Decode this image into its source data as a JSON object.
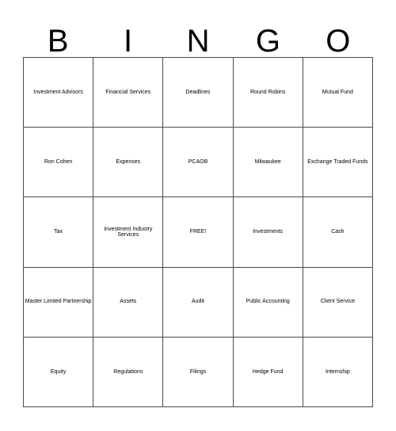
{
  "card": {
    "title": "BINGO Card",
    "header_letters": [
      "B",
      "I",
      "N",
      "G",
      "O"
    ],
    "free_space_label": "FREE!",
    "grid_size": "5x5",
    "colors": {
      "background": "#ffffff",
      "text": "#000000",
      "border": "#4a4a4a"
    },
    "columns": [
      {
        "letter": "B",
        "cells": [
          {
            "text": "Investment Advisors",
            "lines": 2,
            "size": "xxs"
          },
          {
            "text": "Ron Cohen",
            "lines": 2,
            "size": "lg"
          },
          {
            "text": "Tax",
            "lines": 1,
            "size": "xl"
          },
          {
            "text": "Master Limited Partnership",
            "lines": 3,
            "size": "tiny"
          },
          {
            "text": "Equity",
            "lines": 1,
            "size": "md"
          }
        ]
      },
      {
        "letter": "I",
        "cells": [
          {
            "text": "Financial Services",
            "lines": 2,
            "size": "md"
          },
          {
            "text": "Expenses",
            "lines": 1,
            "size": "xs"
          },
          {
            "text": "Investment Industry Services",
            "lines": 3,
            "size": "tiny"
          },
          {
            "text": "Assets",
            "lines": 1,
            "size": "md"
          },
          {
            "text": "Regulations",
            "lines": 1,
            "size": "xxs"
          }
        ]
      },
      {
        "letter": "N",
        "cells": [
          {
            "text": "Deadlines",
            "lines": 1,
            "size": "xs"
          },
          {
            "text": "PCAOB",
            "lines": 1,
            "size": "md"
          },
          {
            "text": "FREE!",
            "lines": 1,
            "size": "md"
          },
          {
            "text": "Audit",
            "lines": 1,
            "size": "xl"
          },
          {
            "text": "Filings",
            "lines": 1,
            "size": "md"
          }
        ]
      },
      {
        "letter": "G",
        "cells": [
          {
            "text": "Round Robins",
            "lines": 2,
            "size": "lg"
          },
          {
            "text": "Milwaukee",
            "lines": 1,
            "size": "xxs"
          },
          {
            "text": "Investments",
            "lines": 1,
            "size": "xxs"
          },
          {
            "text": "Public Accounting",
            "lines": 2,
            "size": "xs"
          },
          {
            "text": "Hedge Fund",
            "lines": 2,
            "size": "lg"
          }
        ]
      },
      {
        "letter": "O",
        "cells": [
          {
            "text": "Mutual Fund",
            "lines": 2,
            "size": "lg"
          },
          {
            "text": "Exchange Traded Funds",
            "lines": 3,
            "size": "xs"
          },
          {
            "text": "Cash",
            "lines": 1,
            "size": "xl"
          },
          {
            "text": "Client Service",
            "lines": 2,
            "size": "md"
          },
          {
            "text": "Internship",
            "lines": 1,
            "size": "xxs"
          }
        ]
      }
    ],
    "rows": [
      [
        "Investment Advisors",
        "Financial Services",
        "Deadlines",
        "Round Robins",
        "Mutual Fund"
      ],
      [
        "Ron Cohen",
        "Expenses",
        "PCAOB",
        "Milwaukee",
        "Exchange Traded Funds"
      ],
      [
        "Tax",
        "Investment Industry Services",
        "FREE!",
        "Investments",
        "Cash"
      ],
      [
        "Master Limited Partnership",
        "Assets",
        "Audit",
        "Public Accounting",
        "Client Service"
      ],
      [
        "Equity",
        "Regulations",
        "Filings",
        "Hedge Fund",
        "Internship"
      ]
    ]
  }
}
